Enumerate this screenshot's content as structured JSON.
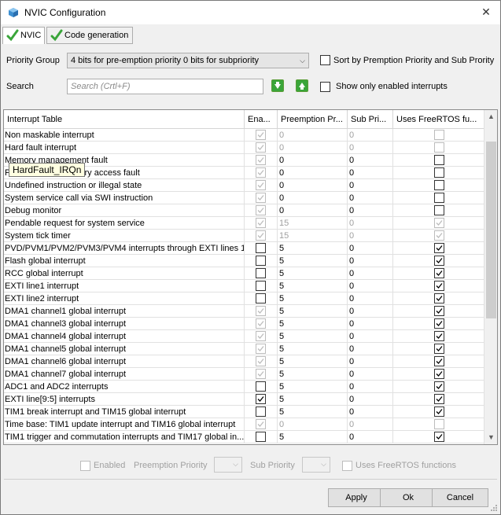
{
  "window": {
    "title": "NVIC Configuration"
  },
  "tabs": [
    {
      "label": "NVIC",
      "active": true
    },
    {
      "label": "Code generation",
      "active": false
    }
  ],
  "priority_group": {
    "label": "Priority Group",
    "value": "4 bits for pre-emption priority 0 bits for subpriority"
  },
  "sort_option": {
    "label": "Sort by Premption Priority and Sub Prority",
    "checked": false
  },
  "search": {
    "label": "Search",
    "placeholder": "Search (Crtl+F)"
  },
  "show_enabled": {
    "label": "Show only enabled interrupts",
    "checked": false
  },
  "table": {
    "columns": [
      "Interrupt Table",
      "Ena...",
      "Preemption Pr...",
      "Sub Pri...",
      "Uses FreeRTOS fu..."
    ],
    "rows": [
      {
        "name": "Non maskable interrupt",
        "enabled": true,
        "en_disabled": true,
        "pre": "0",
        "sub": "0",
        "pre_disabled": true,
        "rtos": false,
        "rtos_disabled": true
      },
      {
        "name": "Hard fault interrupt",
        "enabled": true,
        "en_disabled": true,
        "pre": "0",
        "sub": "0",
        "pre_disabled": true,
        "rtos": false,
        "rtos_disabled": true
      },
      {
        "name": "Memory management fault",
        "enabled": true,
        "en_disabled": true,
        "pre": "0",
        "sub": "0",
        "pre_disabled": false,
        "rtos": false,
        "rtos_disabled": false
      },
      {
        "name": "Prefetch fault, memory access fault",
        "enabled": true,
        "en_disabled": true,
        "pre": "0",
        "sub": "0",
        "pre_disabled": false,
        "rtos": false,
        "rtos_disabled": false
      },
      {
        "name": "Undefined instruction or illegal state",
        "enabled": true,
        "en_disabled": true,
        "pre": "0",
        "sub": "0",
        "pre_disabled": false,
        "rtos": false,
        "rtos_disabled": false
      },
      {
        "name": "System service call via SWI instruction",
        "enabled": true,
        "en_disabled": true,
        "pre": "0",
        "sub": "0",
        "pre_disabled": false,
        "rtos": false,
        "rtos_disabled": false
      },
      {
        "name": "Debug monitor",
        "enabled": true,
        "en_disabled": true,
        "pre": "0",
        "sub": "0",
        "pre_disabled": false,
        "rtos": false,
        "rtos_disabled": false
      },
      {
        "name": "Pendable request for system service",
        "enabled": true,
        "en_disabled": true,
        "pre": "15",
        "sub": "0",
        "pre_disabled": true,
        "rtos": true,
        "rtos_disabled": true
      },
      {
        "name": "System tick timer",
        "enabled": true,
        "en_disabled": true,
        "pre": "15",
        "sub": "0",
        "pre_disabled": true,
        "rtos": true,
        "rtos_disabled": true
      },
      {
        "name": "PVD/PVM1/PVM2/PVM3/PVM4 interrupts through EXTI lines 1...",
        "enabled": false,
        "en_disabled": false,
        "pre": "5",
        "sub": "0",
        "pre_disabled": false,
        "rtos": true,
        "rtos_disabled": false
      },
      {
        "name": "Flash global interrupt",
        "enabled": false,
        "en_disabled": false,
        "pre": "5",
        "sub": "0",
        "pre_disabled": false,
        "rtos": true,
        "rtos_disabled": false
      },
      {
        "name": "RCC global interrupt",
        "enabled": false,
        "en_disabled": false,
        "pre": "5",
        "sub": "0",
        "pre_disabled": false,
        "rtos": true,
        "rtos_disabled": false
      },
      {
        "name": "EXTI line1 interrupt",
        "enabled": false,
        "en_disabled": false,
        "pre": "5",
        "sub": "0",
        "pre_disabled": false,
        "rtos": true,
        "rtos_disabled": false
      },
      {
        "name": "EXTI line2 interrupt",
        "enabled": false,
        "en_disabled": false,
        "pre": "5",
        "sub": "0",
        "pre_disabled": false,
        "rtos": true,
        "rtos_disabled": false
      },
      {
        "name": "DMA1 channel1 global interrupt",
        "enabled": true,
        "en_disabled": true,
        "pre": "5",
        "sub": "0",
        "pre_disabled": false,
        "rtos": true,
        "rtos_disabled": false
      },
      {
        "name": "DMA1 channel3 global interrupt",
        "enabled": true,
        "en_disabled": true,
        "pre": "5",
        "sub": "0",
        "pre_disabled": false,
        "rtos": true,
        "rtos_disabled": false
      },
      {
        "name": "DMA1 channel4 global interrupt",
        "enabled": true,
        "en_disabled": true,
        "pre": "5",
        "sub": "0",
        "pre_disabled": false,
        "rtos": true,
        "rtos_disabled": false
      },
      {
        "name": "DMA1 channel5 global interrupt",
        "enabled": true,
        "en_disabled": true,
        "pre": "5",
        "sub": "0",
        "pre_disabled": false,
        "rtos": true,
        "rtos_disabled": false
      },
      {
        "name": "DMA1 channel6 global interrupt",
        "enabled": true,
        "en_disabled": true,
        "pre": "5",
        "sub": "0",
        "pre_disabled": false,
        "rtos": true,
        "rtos_disabled": false
      },
      {
        "name": "DMA1 channel7 global interrupt",
        "enabled": true,
        "en_disabled": true,
        "pre": "5",
        "sub": "0",
        "pre_disabled": false,
        "rtos": true,
        "rtos_disabled": false
      },
      {
        "name": "ADC1 and ADC2 interrupts",
        "enabled": false,
        "en_disabled": false,
        "pre": "5",
        "sub": "0",
        "pre_disabled": false,
        "rtos": true,
        "rtos_disabled": false
      },
      {
        "name": "EXTI line[9:5] interrupts",
        "enabled": true,
        "en_disabled": false,
        "pre": "5",
        "sub": "0",
        "pre_disabled": false,
        "rtos": true,
        "rtos_disabled": false
      },
      {
        "name": "TIM1 break interrupt and TIM15 global interrupt",
        "enabled": false,
        "en_disabled": false,
        "pre": "5",
        "sub": "0",
        "pre_disabled": false,
        "rtos": true,
        "rtos_disabled": false
      },
      {
        "name": "Time base: TIM1 update interrupt and TIM16 global interrupt",
        "enabled": true,
        "en_disabled": true,
        "pre": "0",
        "sub": "0",
        "pre_disabled": true,
        "rtos": false,
        "rtos_disabled": true
      },
      {
        "name": "TIM1 trigger and commutation interrupts and TIM17 global in...",
        "enabled": false,
        "en_disabled": false,
        "pre": "5",
        "sub": "0",
        "pre_disabled": false,
        "rtos": true,
        "rtos_disabled": false
      }
    ]
  },
  "tooltip": "HardFault_IRQn",
  "details": {
    "enabled_label": "Enabled",
    "preemption_label": "Preemption Priority",
    "sub_label": "Sub Priority",
    "rtos_label": "Uses FreeRTOS functions"
  },
  "buttons": {
    "apply": "Apply",
    "ok": "Ok",
    "cancel": "Cancel"
  },
  "colors": {
    "check_green": "#3aa53a",
    "tooltip_bg": "#ffffe1",
    "disabled_text": "#a0a0a0"
  }
}
